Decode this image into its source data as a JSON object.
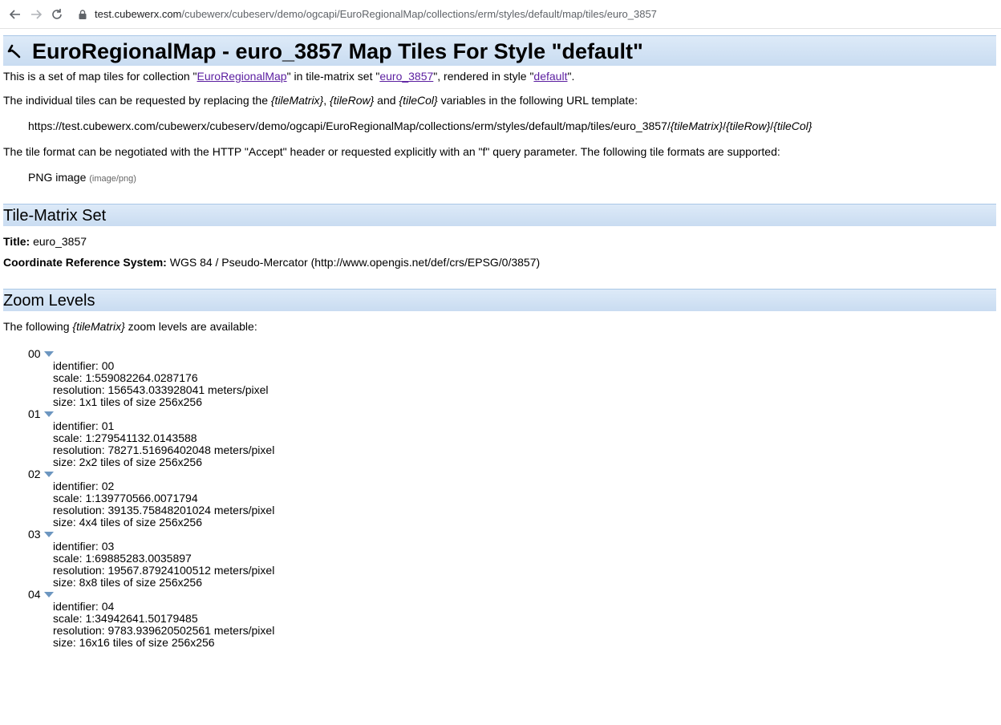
{
  "browser": {
    "url_host": "test.cubewerx.com",
    "url_path": "/cubewerx/cubeserv/demo/ogcapi/EuroRegionalMap/collections/erm/styles/default/map/tiles/euro_3857"
  },
  "page": {
    "title": "EuroRegionalMap - euro_3857 Map Tiles For Style \"default\"",
    "intro": {
      "t1": "This is a set of map tiles for collection \"",
      "collection_link": "EuroRegionalMap",
      "t2": "\" in tile-matrix set \"",
      "tms_link": "euro_3857",
      "t3": "\", rendered in style \"",
      "style_link": "default",
      "t4": "\"."
    },
    "template_intro": {
      "t1": "The individual tiles can be requested by replacing the ",
      "v1": "{tileMatrix}",
      "t2": ", ",
      "v2": "{tileRow}",
      "t3": " and ",
      "v3": "{tileCol}",
      "t4": " variables in the following URL template:"
    },
    "url_template": {
      "base": "https://test.cubewerx.com/cubewerx/cubeserv/demo/ogcapi/EuroRegionalMap/collections/erm/styles/default/map/tiles/euro_3857/",
      "v1": "{tileMatrix}",
      "s1": "/",
      "v2": "{tileRow}",
      "s2": "/",
      "v3": "{tileCol}"
    },
    "format_intro": "The tile format can be negotiated with the HTTP \"Accept\" header or requested explicitly with an \"f\" query parameter. The following tile formats are supported:",
    "format": {
      "name": "PNG image",
      "mime": "(image/png)"
    },
    "tms_section": {
      "heading": "Tile-Matrix Set",
      "title_label": "Title:",
      "title_value": " euro_3857",
      "crs_label": "Coordinate Reference System:",
      "crs_value": " WGS 84 / Pseudo-Mercator (http://www.opengis.net/def/crs/EPSG/0/3857)"
    },
    "zoom_section": {
      "heading": "Zoom Levels",
      "intro_t1": "The following ",
      "intro_var": "{tileMatrix}",
      "intro_t2": " zoom levels are available:",
      "levels": [
        {
          "id": "00",
          "identifier": "identifier: 00",
          "scale": "scale: 1:559082264.0287176",
          "resolution": "resolution: 156543.033928041 meters/pixel",
          "size": "size: 1x1 tiles of size 256x256"
        },
        {
          "id": "01",
          "identifier": "identifier: 01",
          "scale": "scale: 1:279541132.0143588",
          "resolution": "resolution: 78271.51696402048 meters/pixel",
          "size": "size: 2x2 tiles of size 256x256"
        },
        {
          "id": "02",
          "identifier": "identifier: 02",
          "scale": "scale: 1:139770566.0071794",
          "resolution": "resolution: 39135.75848201024 meters/pixel",
          "size": "size: 4x4 tiles of size 256x256"
        },
        {
          "id": "03",
          "identifier": "identifier: 03",
          "scale": "scale: 1:69885283.0035897",
          "resolution": "resolution: 19567.87924100512 meters/pixel",
          "size": "size: 8x8 tiles of size 256x256"
        },
        {
          "id": "04",
          "identifier": "identifier: 04",
          "scale": "scale: 1:34942641.50179485",
          "resolution": "resolution: 9783.939620502561 meters/pixel",
          "size": "size: 16x16 tiles of size 256x256"
        }
      ]
    }
  },
  "colors": {
    "header_band": "#c9dcf1",
    "link": "#5b1ea0",
    "triangle": "#6c96c0"
  }
}
